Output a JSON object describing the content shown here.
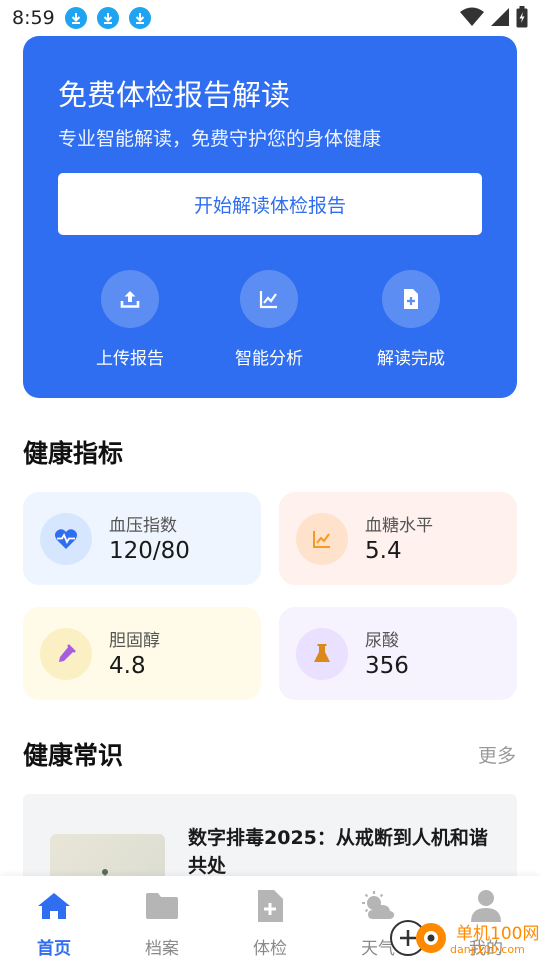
{
  "status_bar": {
    "time": "8:59",
    "download_icon_count": 3
  },
  "hero": {
    "title": "免费体检报告解读",
    "subtitle": "专业智能解读，免费守护您的身体健康",
    "button_label": "开始解读体检报告",
    "steps": [
      {
        "label": "上传报告",
        "icon": "upload-icon"
      },
      {
        "label": "智能分析",
        "icon": "analysis-chart-icon"
      },
      {
        "label": "解读完成",
        "icon": "document-plus-icon"
      }
    ],
    "color": "#2f6ef0"
  },
  "health_metrics": {
    "title": "健康指标",
    "items": [
      {
        "label": "血压指数",
        "value": "120/80",
        "icon": "heartbeat-icon",
        "bg": "#eef5ff",
        "icon_bg": "#d6e6ff",
        "icon_color": "#2f6ef0"
      },
      {
        "label": "血糖水平",
        "value": "5.4",
        "icon": "line-chart-icon",
        "bg": "#fff1ee",
        "icon_bg": "#ffe2cc",
        "icon_color": "#f59a23"
      },
      {
        "label": "胆固醇",
        "value": "4.8",
        "icon": "dropper-icon",
        "bg": "#fffbe8",
        "icon_bg": "#fbefc4",
        "icon_color": "#a65de0"
      },
      {
        "label": "尿酸",
        "value": "356",
        "icon": "flask-icon",
        "bg": "#f6f3ff",
        "icon_bg": "#e9e1ff",
        "icon_color": "#d98a1a"
      }
    ]
  },
  "health_knowledge": {
    "title": "健康常识",
    "more_label": "更多",
    "articles": [
      {
        "title": "数字排毒2025：从戒断到人机和谐共处"
      }
    ]
  },
  "bottom_nav": {
    "items": [
      {
        "label": "首页",
        "icon": "home-icon",
        "active": true
      },
      {
        "label": "档案",
        "icon": "folder-icon",
        "active": false
      },
      {
        "label": "体检",
        "icon": "medical-document-icon",
        "active": false
      },
      {
        "label": "天气",
        "icon": "weather-icon",
        "active": false
      },
      {
        "label": "我的",
        "icon": "user-icon",
        "active": false
      }
    ],
    "active_color": "#2f6ef0",
    "inactive_color": "#b5b5b5"
  },
  "watermark": {
    "text": "单机100网",
    "domain": "danji100.com"
  }
}
